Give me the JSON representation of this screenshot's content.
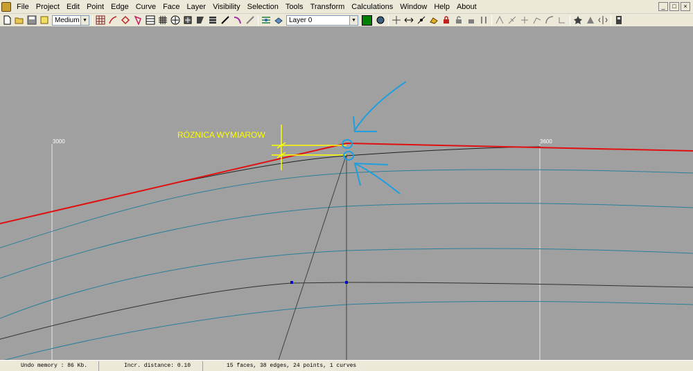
{
  "menu": [
    "File",
    "Project",
    "Edit",
    "Point",
    "Edge",
    "Curve",
    "Face",
    "Layer",
    "Visibility",
    "Selection",
    "Tools",
    "Transform",
    "Calculations",
    "Window",
    "Help",
    "About"
  ],
  "window_controls": [
    "_",
    "□",
    "×"
  ],
  "toolbar": {
    "resolution_value": "Medium",
    "layer_value": "Layer 0",
    "layer_color": "#008000"
  },
  "viewport": {
    "axis_labels": [
      "3000",
      "3600"
    ],
    "annotation_text": "RÓZNICA WYMIAROW",
    "colors": {
      "background": "#a0a0a0",
      "red_edge": "#e01010",
      "black_edge": "#202020",
      "waterline": "#2a7f9a",
      "grid": "#e8e8e8",
      "annotation": "#ffff00",
      "arrow": "#1e9fe0",
      "point": "#0000c0"
    }
  },
  "status": {
    "undo_memory": "Undo memory : 86 Kb.",
    "incr_distance": "Incr. distance: 0.10",
    "model_info": "15 faces, 38 edges, 24 points, 1 curves"
  }
}
